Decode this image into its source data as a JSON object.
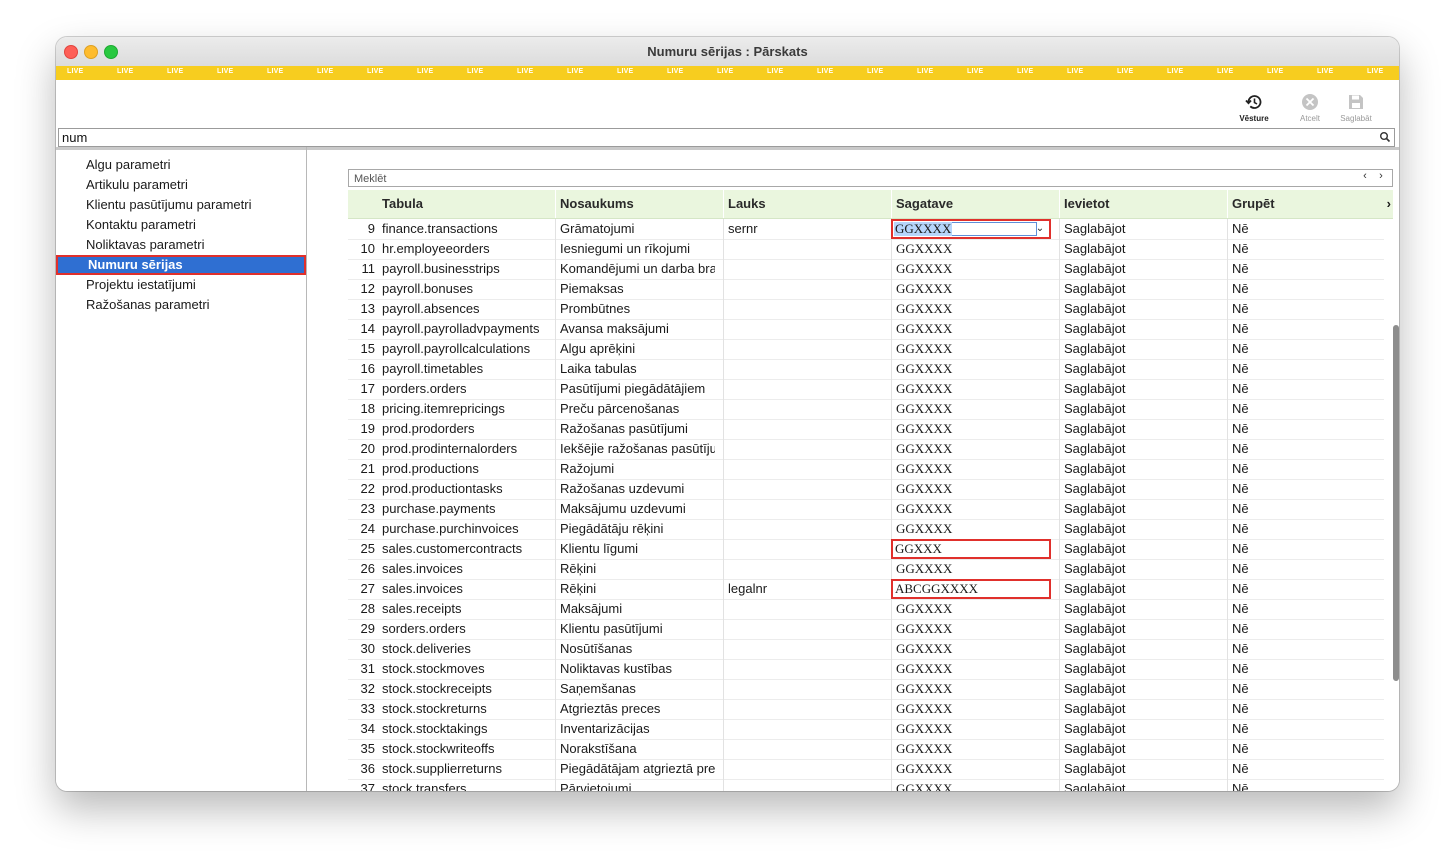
{
  "window": {
    "title": "Numuru sērijas : Pārskats"
  },
  "live_banner": {
    "label": "LIVE",
    "count": 27
  },
  "toolbar": {
    "history_label": "Vēsture",
    "cancel_label": "Atcelt",
    "save_label": "Saglabāt"
  },
  "search": {
    "value": "num"
  },
  "sidebar": {
    "items": [
      {
        "label": "Algu parametri",
        "selected": false
      },
      {
        "label": "Artikulu parametri",
        "selected": false
      },
      {
        "label": "Klientu pasūtījumu parametri",
        "selected": false
      },
      {
        "label": "Kontaktu parametri",
        "selected": false
      },
      {
        "label": "Noliktavas parametri",
        "selected": false
      },
      {
        "label": "Numuru sērijas",
        "selected": true
      },
      {
        "label": "Projektu iestatījumi",
        "selected": false
      },
      {
        "label": "Ražošanas parametri",
        "selected": false
      }
    ]
  },
  "filter": {
    "placeholder": "Meklēt"
  },
  "table": {
    "columns": [
      "Tabula",
      "Nosaukums",
      "Lauks",
      "Sagatave",
      "Ievietot",
      "Grupēt"
    ],
    "rows": [
      {
        "n": "9",
        "tabula": "finance.transactions",
        "nosaukums": "Grāmatojumi",
        "lauks": "sernr",
        "sagatave": "GGXXXX",
        "ievietot": "Saglabājot",
        "grupet": "Nē",
        "editing": true
      },
      {
        "n": "10",
        "tabula": "hr.employeeorders",
        "nosaukums": "Iesniegumi un rīkojumi",
        "lauks": "",
        "sagatave": "GGXXXX",
        "ievietot": "Saglabājot",
        "grupet": "Nē"
      },
      {
        "n": "11",
        "tabula": "payroll.businesstrips",
        "nosaukums": "Komandējumi un darba brau",
        "lauks": "",
        "sagatave": "GGXXXX",
        "ievietot": "Saglabājot",
        "grupet": "Nē"
      },
      {
        "n": "12",
        "tabula": "payroll.bonuses",
        "nosaukums": "Piemaksas",
        "lauks": "",
        "sagatave": "GGXXXX",
        "ievietot": "Saglabājot",
        "grupet": "Nē"
      },
      {
        "n": "13",
        "tabula": "payroll.absences",
        "nosaukums": "Prombūtnes",
        "lauks": "",
        "sagatave": "GGXXXX",
        "ievietot": "Saglabājot",
        "grupet": "Nē"
      },
      {
        "n": "14",
        "tabula": "payroll.payrolladvpayments",
        "nosaukums": "Avansa maksājumi",
        "lauks": "",
        "sagatave": "GGXXXX",
        "ievietot": "Saglabājot",
        "grupet": "Nē"
      },
      {
        "n": "15",
        "tabula": "payroll.payrollcalculations",
        "nosaukums": "Algu aprēķini",
        "lauks": "",
        "sagatave": "GGXXXX",
        "ievietot": "Saglabājot",
        "grupet": "Nē"
      },
      {
        "n": "16",
        "tabula": "payroll.timetables",
        "nosaukums": "Laika tabulas",
        "lauks": "",
        "sagatave": "GGXXXX",
        "ievietot": "Saglabājot",
        "grupet": "Nē"
      },
      {
        "n": "17",
        "tabula": "porders.orders",
        "nosaukums": "Pasūtījumi piegādātājiem",
        "lauks": "",
        "sagatave": "GGXXXX",
        "ievietot": "Saglabājot",
        "grupet": "Nē"
      },
      {
        "n": "18",
        "tabula": "pricing.itemrepricings",
        "nosaukums": "Preču pārcenošanas",
        "lauks": "",
        "sagatave": "GGXXXX",
        "ievietot": "Saglabājot",
        "grupet": "Nē"
      },
      {
        "n": "19",
        "tabula": "prod.prodorders",
        "nosaukums": "Ražošanas pasūtījumi",
        "lauks": "",
        "sagatave": "GGXXXX",
        "ievietot": "Saglabājot",
        "grupet": "Nē"
      },
      {
        "n": "20",
        "tabula": "prod.prodinternalorders",
        "nosaukums": "Iekšējie ražošanas pasūtījum",
        "lauks": "",
        "sagatave": "GGXXXX",
        "ievietot": "Saglabājot",
        "grupet": "Nē"
      },
      {
        "n": "21",
        "tabula": "prod.productions",
        "nosaukums": "Ražojumi",
        "lauks": "",
        "sagatave": "GGXXXX",
        "ievietot": "Saglabājot",
        "grupet": "Nē"
      },
      {
        "n": "22",
        "tabula": "prod.productiontasks",
        "nosaukums": "Ražošanas uzdevumi",
        "lauks": "",
        "sagatave": "GGXXXX",
        "ievietot": "Saglabājot",
        "grupet": "Nē"
      },
      {
        "n": "23",
        "tabula": "purchase.payments",
        "nosaukums": "Maksājumu uzdevumi",
        "lauks": "",
        "sagatave": "GGXXXX",
        "ievietot": "Saglabājot",
        "grupet": "Nē"
      },
      {
        "n": "24",
        "tabula": "purchase.purchinvoices",
        "nosaukums": "Piegādātāju rēķini",
        "lauks": "",
        "sagatave": "GGXXXX",
        "ievietot": "Saglabājot",
        "grupet": "Nē"
      },
      {
        "n": "25",
        "tabula": "sales.customercontracts",
        "nosaukums": "Klientu līgumi",
        "lauks": "",
        "sagatave": "GGXXX",
        "ievietot": "Saglabājot",
        "grupet": "Nē",
        "marked": true
      },
      {
        "n": "26",
        "tabula": "sales.invoices",
        "nosaukums": "Rēķini",
        "lauks": "",
        "sagatave": "GGXXXX",
        "ievietot": "Saglabājot",
        "grupet": "Nē"
      },
      {
        "n": "27",
        "tabula": "sales.invoices",
        "nosaukums": "Rēķini",
        "lauks": "legalnr",
        "sagatave": "ABCGGXXXX",
        "ievietot": "Saglabājot",
        "grupet": "Nē",
        "marked": true
      },
      {
        "n": "28",
        "tabula": "sales.receipts",
        "nosaukums": "Maksājumi",
        "lauks": "",
        "sagatave": "GGXXXX",
        "ievietot": "Saglabājot",
        "grupet": "Nē"
      },
      {
        "n": "29",
        "tabula": "sorders.orders",
        "nosaukums": "Klientu pasūtījumi",
        "lauks": "",
        "sagatave": "GGXXXX",
        "ievietot": "Saglabājot",
        "grupet": "Nē"
      },
      {
        "n": "30",
        "tabula": "stock.deliveries",
        "nosaukums": "Nosūtīšanas",
        "lauks": "",
        "sagatave": "GGXXXX",
        "ievietot": "Saglabājot",
        "grupet": "Nē"
      },
      {
        "n": "31",
        "tabula": "stock.stockmoves",
        "nosaukums": "Noliktavas kustības",
        "lauks": "",
        "sagatave": "GGXXXX",
        "ievietot": "Saglabājot",
        "grupet": "Nē"
      },
      {
        "n": "32",
        "tabula": "stock.stockreceipts",
        "nosaukums": "Saņemšanas",
        "lauks": "",
        "sagatave": "GGXXXX",
        "ievietot": "Saglabājot",
        "grupet": "Nē"
      },
      {
        "n": "33",
        "tabula": "stock.stockreturns",
        "nosaukums": "Atgrieztās preces",
        "lauks": "",
        "sagatave": "GGXXXX",
        "ievietot": "Saglabājot",
        "grupet": "Nē"
      },
      {
        "n": "34",
        "tabula": "stock.stocktakings",
        "nosaukums": "Inventarizācijas",
        "lauks": "",
        "sagatave": "GGXXXX",
        "ievietot": "Saglabājot",
        "grupet": "Nē"
      },
      {
        "n": "35",
        "tabula": "stock.stockwriteoffs",
        "nosaukums": "Norakstīšana",
        "lauks": "",
        "sagatave": "GGXXXX",
        "ievietot": "Saglabājot",
        "grupet": "Nē"
      },
      {
        "n": "36",
        "tabula": "stock.supplierreturns",
        "nosaukums": "Piegādātājam atgrieztā prece",
        "lauks": "",
        "sagatave": "GGXXXX",
        "ievietot": "Saglabājot",
        "grupet": "Nē"
      },
      {
        "n": "37",
        "tabula": "stock.transfers",
        "nosaukums": "Pārvietojumi",
        "lauks": "",
        "sagatave": "GGXXXX",
        "ievietot": "Saglabājot",
        "grupet": "Nē"
      }
    ]
  },
  "colors": {
    "live_banner": "#f7cd1f",
    "selection": "#2f6fd2",
    "highlight_border": "#e0302c",
    "header_bg": "#eaf6de"
  }
}
